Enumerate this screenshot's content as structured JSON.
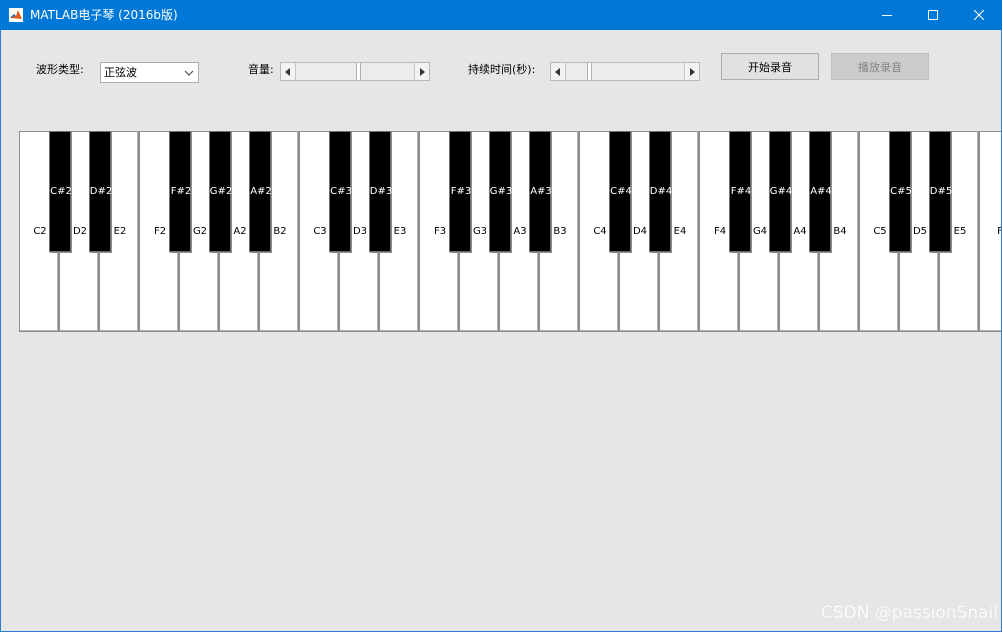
{
  "window": {
    "title": "MATLAB电子琴 (2016b版)",
    "icons": {
      "app": "matlab-icon",
      "minimize": "minimize-icon",
      "maximize": "maximize-icon",
      "close": "close-icon"
    }
  },
  "controls": {
    "waveform_label": "波形类型:",
    "waveform_value": "正弦波",
    "volume_label": "音量:",
    "volume_level": 0.53,
    "duration_label": "持续时间(秒):",
    "duration_level": 0.2,
    "record_button": "开始录音",
    "play_button": "播放录音",
    "play_button_enabled": false
  },
  "keyboard": {
    "white_keys": [
      "C2",
      "D2",
      "E2",
      "F2",
      "G2",
      "A2",
      "B2",
      "C3",
      "D3",
      "E3",
      "F3",
      "G3",
      "A3",
      "B3",
      "C4",
      "D4",
      "E4",
      "F4",
      "G4",
      "A4",
      "B4",
      "C5",
      "D5",
      "E5",
      "F"
    ],
    "black_keys": [
      {
        "label": "C#2",
        "after": 0
      },
      {
        "label": "D#2",
        "after": 1
      },
      {
        "label": "F#2",
        "after": 3
      },
      {
        "label": "G#2",
        "after": 4
      },
      {
        "label": "A#2",
        "after": 5
      },
      {
        "label": "C#3",
        "after": 7
      },
      {
        "label": "D#3",
        "after": 8
      },
      {
        "label": "F#3",
        "after": 10
      },
      {
        "label": "G#3",
        "after": 11
      },
      {
        "label": "A#3",
        "after": 12
      },
      {
        "label": "C#4",
        "after": 14
      },
      {
        "label": "D#4",
        "after": 15
      },
      {
        "label": "F#4",
        "after": 17
      },
      {
        "label": "G#4",
        "after": 18
      },
      {
        "label": "A#4",
        "after": 19
      },
      {
        "label": "C#5",
        "after": 21
      },
      {
        "label": "D#5",
        "after": 22
      }
    ]
  },
  "watermark": "CSDN @passionSnail",
  "colors": {
    "titlebar": "#0078d7",
    "background": "#e6e6e6"
  }
}
